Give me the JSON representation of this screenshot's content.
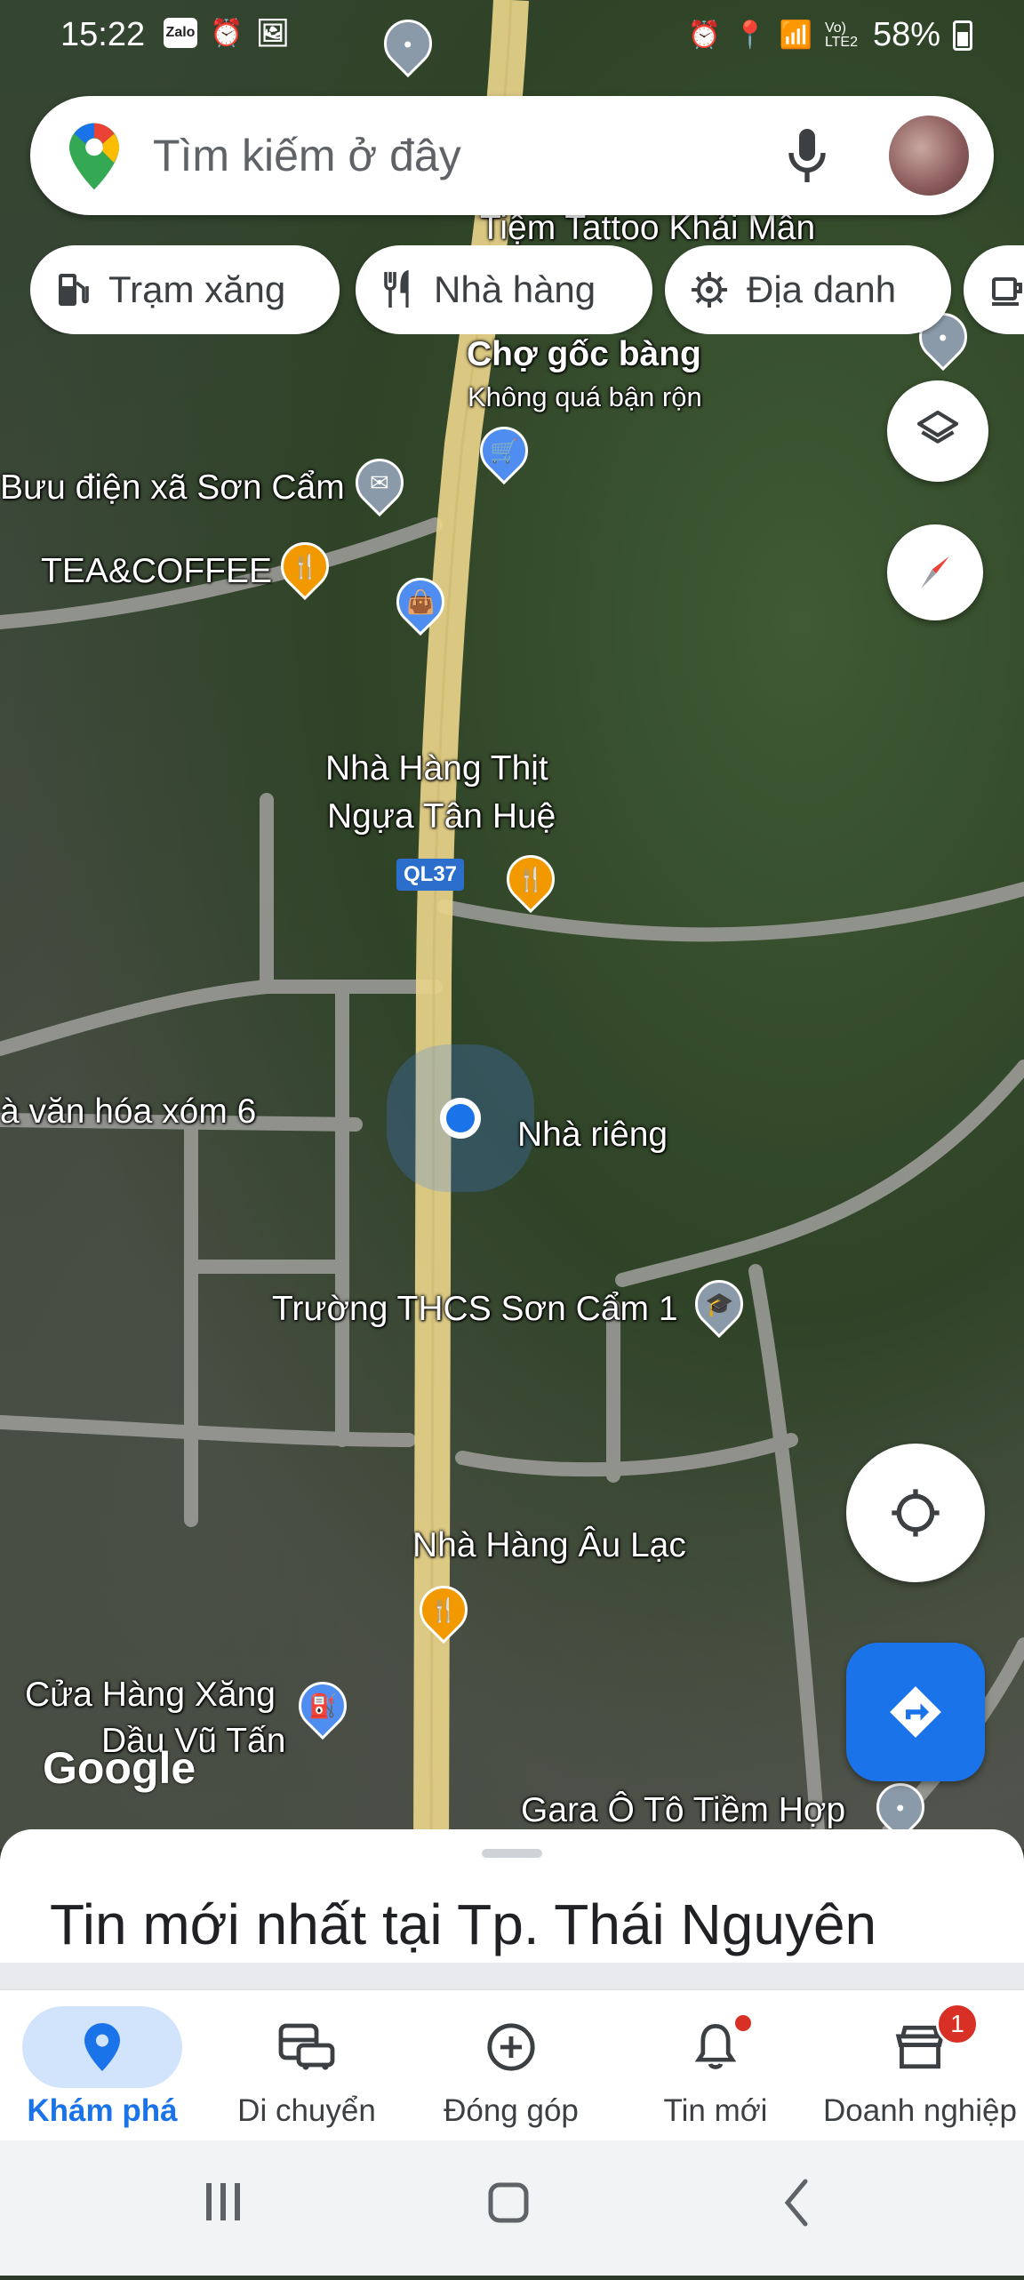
{
  "status_bar": {
    "time": "15:22",
    "left_icons": [
      "Zalo",
      "alarm-icon",
      "gallery-icon"
    ],
    "network": "Vo) LTE2",
    "battery": "58%"
  },
  "search": {
    "placeholder": "Tìm kiếm ở đây"
  },
  "chips": [
    {
      "label": "Trạm xăng",
      "icon": "gas-station-icon"
    },
    {
      "label": "Nhà hàng",
      "icon": "restaurant-icon"
    },
    {
      "label": "Địa danh",
      "icon": "landmark-icon"
    }
  ],
  "map": {
    "labels": {
      "tattoo": "Tiệm Tattoo Khải Mẫn",
      "cho_goc_bang": "Chợ gốc bàng",
      "cho_goc_bang_sub": "Không quá bận rộn",
      "buu_dien": "Bưu điện xã Sơn Cẩm",
      "tea_coffee": "TEA&COFFEE",
      "nha_hang_thit_1": "Nhà Hàng Thịt",
      "nha_hang_thit_2": "Ngựa Tân Huệ",
      "road_shield": "QL37",
      "van_hoa": "à văn hóa xóm 6",
      "nha_rieng": "Nhà riêng",
      "truong": "Trường THCS Sơn Cẩm 1",
      "au_lac": "Nhà Hàng Âu Lạc",
      "xang_1": "Cửa Hàng Xăng",
      "xang_2": "Dầu Vũ Tấn",
      "gara": "Gara Ô Tô Tiềm Hợp",
      "google": "Google"
    }
  },
  "sheet": {
    "title": "Tin mới nhất tại Tp. Thái Nguyên"
  },
  "bottom_nav": [
    {
      "label": "Khám phá",
      "icon": "explore-pin-icon",
      "active": true
    },
    {
      "label": "Di chuyển",
      "icon": "commute-icon",
      "active": false
    },
    {
      "label": "Đóng góp",
      "icon": "contribute-icon",
      "active": false
    },
    {
      "label": "Tin mới",
      "icon": "bell-icon",
      "active": false
    },
    {
      "label": "Doanh nghiệp",
      "icon": "business-icon",
      "active": false,
      "badge": "1"
    }
  ],
  "colors": {
    "accent": "#1a73e8",
    "badge": "#d93025",
    "restaurant_pin": "#f29900",
    "road": "#e8d48a"
  }
}
